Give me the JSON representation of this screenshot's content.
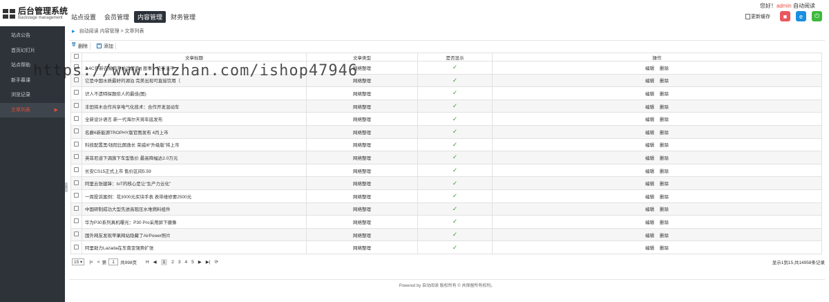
{
  "logo": {
    "title": "后台管理系统",
    "subtitle": "Backstage management"
  },
  "topnav": [
    "站点设置",
    "会员管理",
    "内容管理",
    "财务管理"
  ],
  "user": {
    "greeting": "您好！",
    "name": "admin",
    "action": "自动阅读"
  },
  "refresh_label": "更新缓存",
  "sidebar": [
    {
      "label": "站点公告",
      "active": false
    },
    {
      "label": "首页幻灯片",
      "active": false
    },
    {
      "label": "站点帮助",
      "active": false
    },
    {
      "label": "新手幕课",
      "active": false
    },
    {
      "label": "浏览记录",
      "active": false
    },
    {
      "label": "文章列表",
      "active": true
    }
  ],
  "breadcrumb": "自动阅读 内容管理 > 文章列表",
  "toolbar": {
    "delete": "删除",
    "add": "添加"
  },
  "table": {
    "headers": [
      "文章标题",
      "文章类型",
      "是否显示",
      "操作"
    ],
    "rows": [
      {
        "title": "2.4C开新农易商开始运营商 | 股事：证券法平",
        "type": "网络整理",
        "show": true
      },
      {
        "title": "它是中国水质最好的湖泊 完美出现可直接饮用（",
        "type": "网络整理",
        "show": true
      },
      {
        "title": "识人不遗特探题侬人的最佳(图)",
        "type": "网络整理",
        "show": true
      },
      {
        "title": "丰田将木合作共享电气化技术：合作开发混动车",
        "type": "网络整理",
        "show": true
      },
      {
        "title": "全新设计语言 新一代海尔天将年底发布",
        "type": "网络整理",
        "show": true
      },
      {
        "title": "名爵6新能源TROPHY版官图发布 4月上市",
        "type": "网络整理",
        "show": true
      },
      {
        "title": "科技配置黑/钱阳比朗逸长 荣威i6“升级版”将上市",
        "type": "网络整理",
        "show": true
      },
      {
        "title": "英菲尼迪下调旗下车型售价 最高降幅达2.0万元",
        "type": "网络整理",
        "show": true
      },
      {
        "title": "长安CS15正式上市 售价区间5.59",
        "type": "网络整理",
        "show": true
      },
      {
        "title": "阿里云张建锋：IoT的核心是让“生产力云化”",
        "type": "网络整理",
        "show": true
      },
      {
        "title": "一周投诉案例：花3000元买块手表 表带维修要2500元",
        "type": "网络整理",
        "show": true
      },
      {
        "title": "中国研制成功大型先进高阻压水堆燃料组件",
        "type": "网络整理",
        "show": true
      },
      {
        "title": "华为P30系列真机曝光：P30 Pro采用屏下摄像",
        "type": "网络整理",
        "show": true
      },
      {
        "title": "国外网友发现苹果网站隐藏了AirPower照片",
        "type": "网络整理",
        "show": true
      },
      {
        "title": "阿里助力Lazada在东南亚强势扩张",
        "type": "网络整理",
        "show": true
      }
    ],
    "op_edit": "编辑",
    "op_delete": "删除",
    "check_mark": "✓"
  },
  "pager": {
    "size": "15",
    "page_prefix": "第",
    "page": "1",
    "page_suffix": "共998页",
    "pages": [
      "1",
      "2",
      "3",
      "4",
      "5"
    ],
    "info": "显示1到15,共14958条记录"
  },
  "footer": "Powered by 自动阅读 版权所有 © 共保留所有权利。",
  "watermark": "https://www.huzhan.com/ishop47946"
}
